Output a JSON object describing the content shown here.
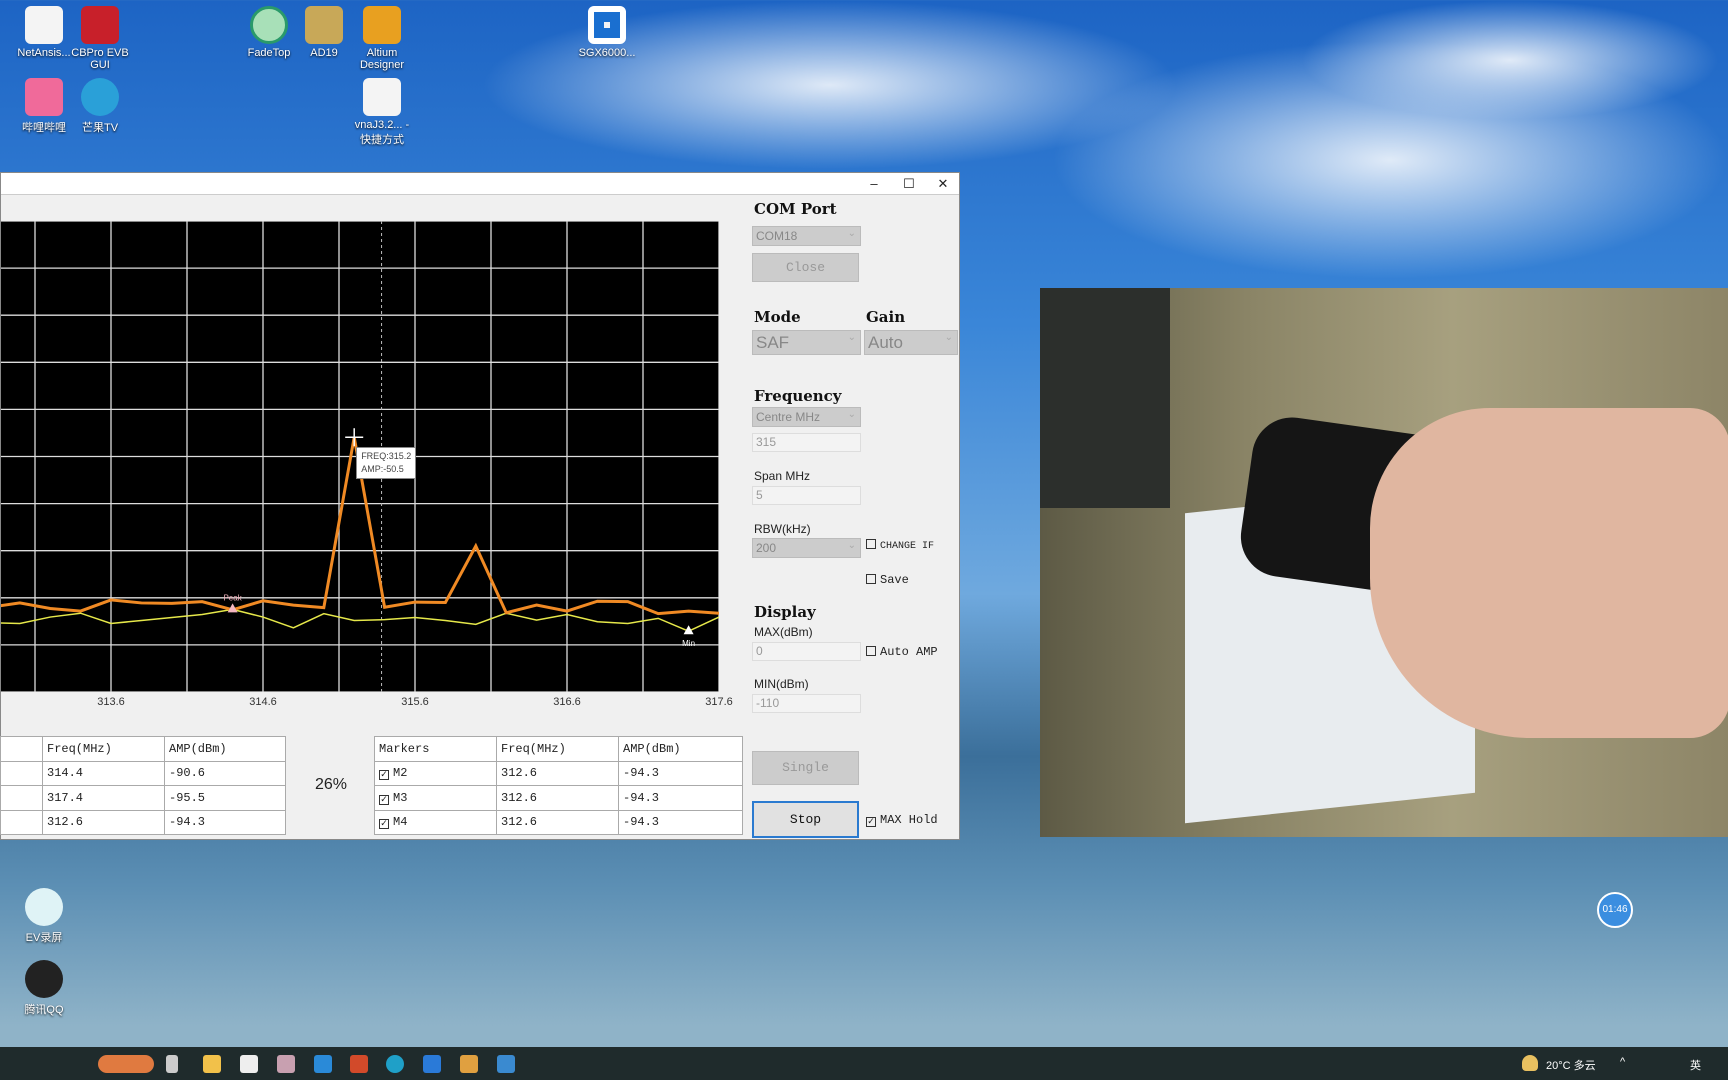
{
  "desktop": {
    "icons": [
      {
        "label": "NetAnsis..."
      },
      {
        "label": "CBPro EVB GUI"
      },
      {
        "label": "FadeTop"
      },
      {
        "label": "AD19"
      },
      {
        "label": "Altium Designer"
      },
      {
        "label": "SGX6000..."
      },
      {
        "label": "哔哩哔哩"
      },
      {
        "label": "芒果TV"
      },
      {
        "label": "vnaJ3.2... - 快捷方式"
      },
      {
        "label": "EV录屏"
      },
      {
        "label": "腾讯QQ"
      }
    ],
    "clock_bubble": "01:46"
  },
  "window": {
    "minimize": "–",
    "maximize": "☐",
    "close": "✕"
  },
  "chart_data": {
    "type": "line",
    "xlim": [
      312.6,
      317.6
    ],
    "ylim": [
      -110,
      0
    ],
    "x_ticks": [
      "313.6",
      "314.6",
      "315.6",
      "316.6",
      "317.6"
    ],
    "grid": true,
    "x": [
      312.8,
      313.0,
      313.2,
      313.4,
      313.6,
      313.8,
      314.0,
      314.2,
      314.4,
      314.6,
      314.8,
      315.0,
      315.2,
      315.4,
      315.6,
      315.8,
      316.0,
      316.2,
      316.4,
      316.6,
      316.8,
      317.0,
      317.2,
      317.4,
      317.6
    ],
    "series": [
      {
        "role": "max-hold",
        "color": "#f08a24",
        "values": [
          -90.2,
          -89.2,
          -90.5,
          -91.1,
          -88.5,
          -89.2,
          -89.3,
          -88.9,
          -90.8,
          -88.7,
          -89.7,
          -90.3,
          -50.5,
          -90.2,
          -89.0,
          -89.1,
          -75.9,
          -91.5,
          -89.7,
          -91.1,
          -88.8,
          -88.9,
          -91.7,
          -91.1,
          -91.6
        ]
      },
      {
        "role": "live",
        "color": "#e6e84a",
        "values": [
          -93.8,
          -94.0,
          -92.5,
          -91.6,
          -94.0,
          -93.3,
          -92.6,
          -91.9,
          -90.7,
          -92.5,
          -95.0,
          -91.7,
          -93.3,
          -93.1,
          -92.6,
          -93.3,
          -94.2,
          -91.6,
          -93.2,
          -91.9,
          -93.6,
          -94.0,
          -92.8,
          -95.8,
          -92.5
        ]
      }
    ],
    "markers": [
      {
        "label": "Peak",
        "x": 314.4,
        "y": -90.7,
        "color": "#f4b6c0"
      },
      {
        "label": "Min",
        "x": 317.4,
        "y": -95.8,
        "color": "#ffffff"
      }
    ],
    "cursor_line_x": 315.38,
    "tooltip": {
      "x": 315.2,
      "y": -50.5,
      "freq": "FREQ:315.2",
      "amp": "AMP:-50.5"
    }
  },
  "peak_table": {
    "headers": [
      "",
      "Freq(MHz)",
      "AMP(dBm)"
    ],
    "rows": [
      [
        "",
        "314.4",
        "-90.6"
      ],
      [
        "",
        "317.4",
        "-95.5"
      ],
      [
        "",
        "312.6",
        "-94.3"
      ]
    ]
  },
  "progress": "26%",
  "marker_table": {
    "headers": [
      "Markers",
      "Freq(MHz)",
      "AMP(dBm)"
    ],
    "rows": [
      [
        "M2",
        "312.6",
        "-94.3"
      ],
      [
        "M3",
        "312.6",
        "-94.3"
      ],
      [
        "M4",
        "312.6",
        "-94.3"
      ]
    ]
  },
  "panel": {
    "com_port_label": "COM Port",
    "com_port": "COM18",
    "close": "Close",
    "mode_label": "Mode",
    "mode": "SAF",
    "gain_label": "Gain",
    "gain": "Auto",
    "frequency_label": "Frequency",
    "freq_mode": "Centre MHz",
    "freq_value": "315",
    "span_label": "Span MHz",
    "span_value": "5",
    "rbw_label": "RBW(kHz)",
    "rbw": "200",
    "change_if": "CHANGE IF",
    "save": "Save",
    "display_label": "Display",
    "max_label": "MAX(dBm)",
    "max_value": "0",
    "auto_amp": "Auto AMP",
    "min_label": "MIN(dBm)",
    "min_value": "-110",
    "single": "Single",
    "stop": "Stop",
    "max_hold": "MAX Hold"
  },
  "taskbar": {
    "weather": "20°C 多云",
    "ime": "英"
  }
}
